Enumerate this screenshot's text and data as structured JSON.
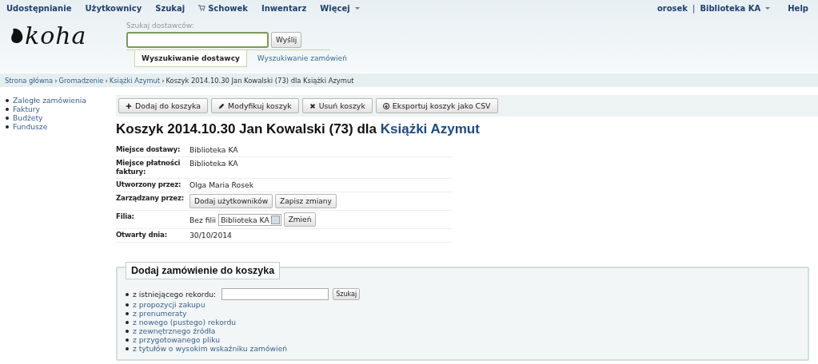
{
  "top_nav": {
    "items": [
      {
        "label": "Udostępnianie",
        "kind": "plain"
      },
      {
        "label": "Użytkownicy",
        "kind": "plain"
      },
      {
        "label": "Szukaj",
        "kind": "plain"
      },
      {
        "label": "Schowek",
        "kind": "cart"
      },
      {
        "label": "Inwentarz",
        "kind": "plain"
      },
      {
        "label": "Więcej",
        "kind": "menu"
      }
    ],
    "user": "orosek",
    "separator": "|",
    "library": "Biblioteka KA",
    "help": "Help"
  },
  "header": {
    "logo_text": "koha",
    "search_label": "Szukaj dostawców:",
    "submit": "Wyślij",
    "tabs": [
      {
        "label": "Wyszukiwanie dostawcy",
        "selected": true
      },
      {
        "label": "Wyszukiwanie zamówień",
        "selected": false
      }
    ]
  },
  "breadcrumbs": {
    "links": [
      "Strona główna",
      "Gromadzenie",
      "Książki Azymut"
    ],
    "separator": "›",
    "current": "Koszyk 2014.10.30 Jan Kowalski (73) dla Książki Azymut"
  },
  "sidebar": {
    "items": [
      "Zaległe zamówienia",
      "Faktury",
      "Budżety",
      "Fundusze"
    ]
  },
  "toolbar": {
    "buttons": [
      {
        "label": "Dodaj do koszyka",
        "kind": "add"
      },
      {
        "label": "Modyfikuj koszyk",
        "kind": "edit"
      },
      {
        "label": "Usuń koszyk",
        "kind": "delete"
      },
      {
        "label": "Eksportuj koszyk jako CSV",
        "kind": "export"
      }
    ]
  },
  "title": {
    "text": "Koszyk 2014.10.30 Jan Kowalski (73) dla",
    "link": "Książki Azymut"
  },
  "details": [
    {
      "label": "Miejsce dostawy:",
      "kind": "text",
      "value": "Biblioteka KA"
    },
    {
      "label": "Miejsce płatności faktury:",
      "kind": "text",
      "value": "Biblioteka KA"
    },
    {
      "label": "Utworzony przez:",
      "kind": "text",
      "value": "Olga Maria Rosek"
    },
    {
      "label": "Zarządzany przez:",
      "kind": "buttons",
      "buttons": [
        "Dodaj użytkowników",
        "Zapisz zmiany"
      ]
    },
    {
      "label": "Filia:",
      "kind": "select",
      "prefix": "Bez filii",
      "select": "Biblioteka KA",
      "button": "Zmień"
    },
    {
      "label": "Otwarty dnia:",
      "kind": "text",
      "value": "30/10/2014"
    }
  ],
  "add_order": {
    "legend": "Dodaj zamówienie do koszyka",
    "search_label": "z istniejącego rekordu:",
    "search_button": "Szukaj",
    "links": [
      "z propozycji zakupu",
      "z prenumeraty",
      "z nowego (pustego) rekordu",
      "z zewnętrznego źródła",
      "z przygotowanego pliku",
      "z tytułów o wysokim wskaźniku zamówień"
    ]
  }
}
